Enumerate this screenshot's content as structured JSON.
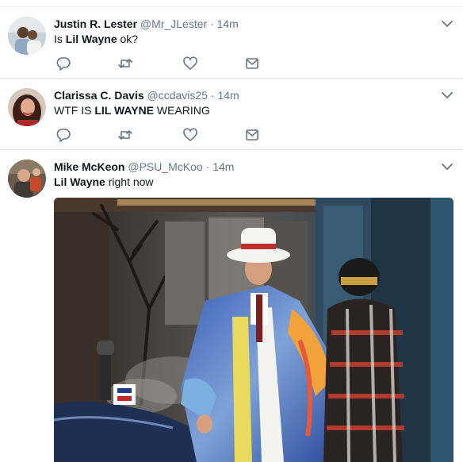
{
  "tweets": [
    {
      "fullname": "Justin R. Lester",
      "username": "@Mr_JLester",
      "dot": "·",
      "time": "14m",
      "text_parts": [
        "Is ",
        "Lil Wayne",
        " ok?"
      ]
    },
    {
      "fullname": "Clarissa C. Davis",
      "username": "@ccdavis25",
      "dot": "·",
      "time": "14m",
      "text_parts": [
        "WTF IS ",
        "LIL WAYNE",
        " WEARING"
      ]
    },
    {
      "fullname": "Mike McKeon",
      "username": "@PSU_McKoo",
      "dot": "·",
      "time": "14m",
      "text_parts": [
        "Lil Wayne",
        " right now"
      ]
    }
  ],
  "icons": {
    "reply": "reply-icon",
    "retweet": "retweet-icon",
    "like": "like-icon",
    "message": "direct-message-icon",
    "caret": "chevron-down-icon"
  },
  "colors": {
    "icon_gray": "#657786",
    "text": "#14171a",
    "divider": "#e6ecf0"
  }
}
